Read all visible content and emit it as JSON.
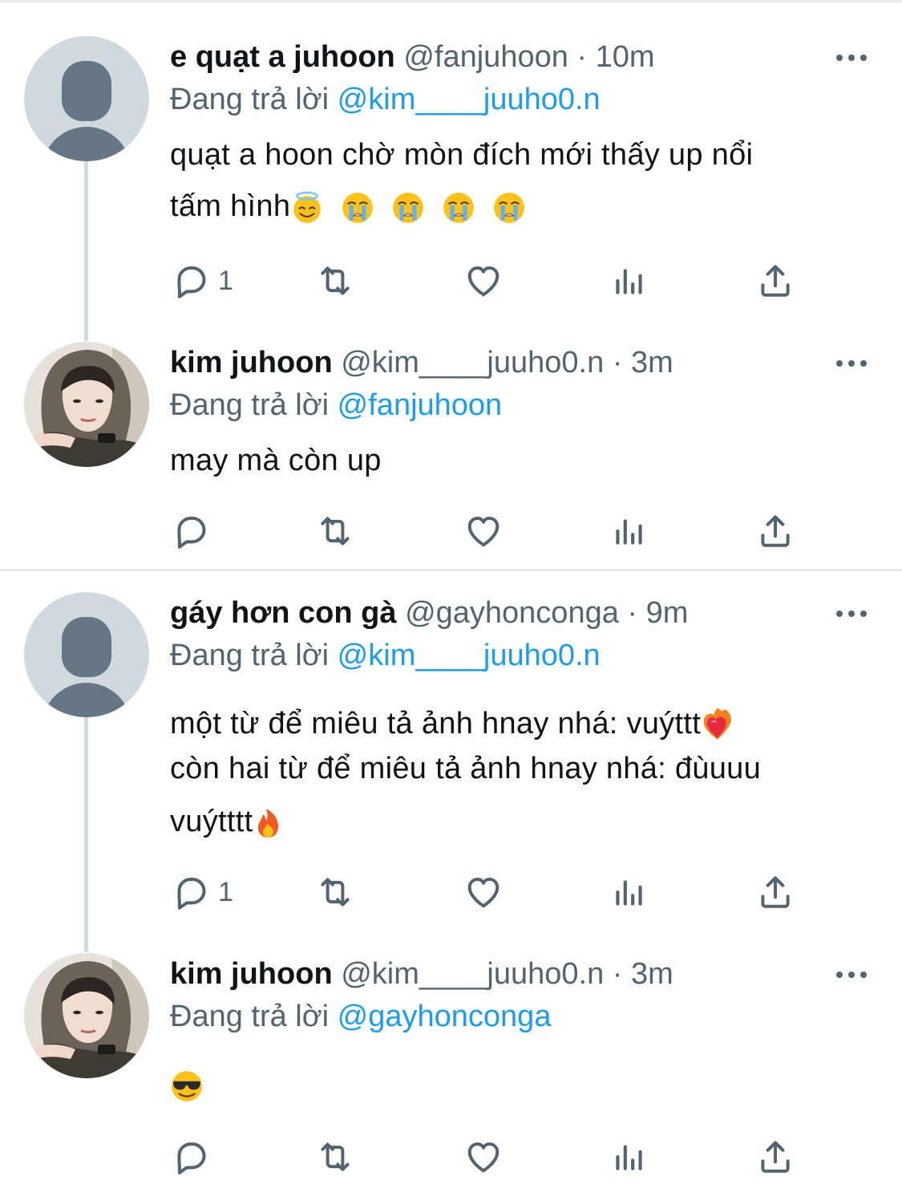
{
  "replying_label": "Đang trả lời",
  "tweets": [
    {
      "name": "e quạt a juhoon",
      "handle": "@fanjuhoon",
      "dot": "·",
      "time": "10m",
      "replying_to": "@kim____juuho0.n",
      "text_lines": [
        "quạt a hoon chờ mòn đích mới thấy up nổi",
        "tấm hình"
      ],
      "emojis": [
        "smiling-face-with-halo",
        "loudly-crying-face",
        "loudly-crying-face",
        "loudly-crying-face",
        "loudly-crying-face"
      ],
      "reply_count": "1"
    },
    {
      "name": "kim juhoon",
      "handle": "@kim____juuho0.n",
      "dot": "·",
      "time": "3m",
      "replying_to": "@fanjuhoon",
      "text_lines": [
        "may mà còn up"
      ],
      "reply_count": ""
    },
    {
      "name": "gáy hơn con gà",
      "handle": "@gayhonconga",
      "dot": "·",
      "time": "9m",
      "replying_to": "@kim____juuho0.n",
      "text_lines": [
        "một từ để miêu tả ảnh hnay nhá: vuýttt",
        "còn hai từ để miêu tả ảnh hnay nhá: đùuuu",
        "vuýtttt"
      ],
      "emojis": [
        "heart-on-fire",
        "fire"
      ],
      "reply_count": "1"
    },
    {
      "name": "kim juhoon",
      "handle": "@kim____juuho0.n",
      "dot": "·",
      "time": "3m",
      "replying_to": "@gayhonconga",
      "text_lines": [
        ""
      ],
      "emojis": [
        "smiling-face-with-sunglasses"
      ],
      "reply_count": ""
    }
  ],
  "icons": [
    "reply-icon",
    "retweet-icon",
    "like-icon",
    "views-icon",
    "share-icon",
    "more-icon"
  ],
  "colors": {
    "link": "#1d9bf0",
    "secondary": "#536471",
    "text": "#0f1419",
    "avatar_bg": "#cfd9de"
  }
}
